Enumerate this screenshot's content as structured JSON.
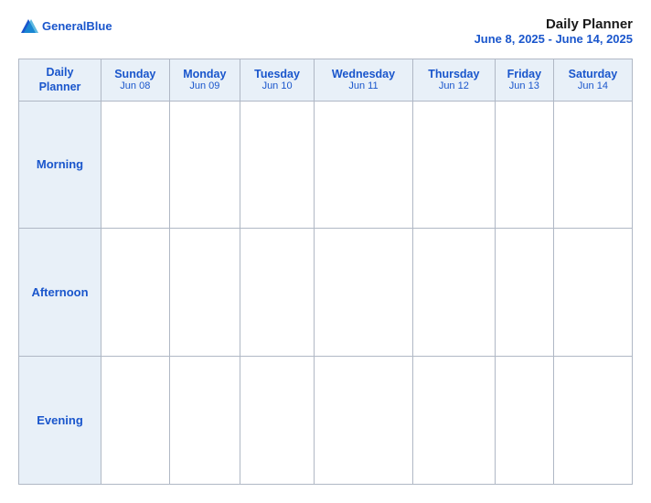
{
  "header": {
    "logo_text_general": "General",
    "logo_text_blue": "Blue",
    "title": "Daily Planner",
    "date_range": "June 8, 2025 - June 14, 2025"
  },
  "table": {
    "header_label": "Daily\nPlanner",
    "days": [
      {
        "name": "Sunday",
        "date": "Jun 08"
      },
      {
        "name": "Monday",
        "date": "Jun 09"
      },
      {
        "name": "Tuesday",
        "date": "Jun 10"
      },
      {
        "name": "Wednesday",
        "date": "Jun 11"
      },
      {
        "name": "Thursday",
        "date": "Jun 12"
      },
      {
        "name": "Friday",
        "date": "Jun 13"
      },
      {
        "name": "Saturday",
        "date": "Jun 14"
      }
    ],
    "rows": [
      {
        "label": "Morning"
      },
      {
        "label": "Afternoon"
      },
      {
        "label": "Evening"
      }
    ]
  }
}
